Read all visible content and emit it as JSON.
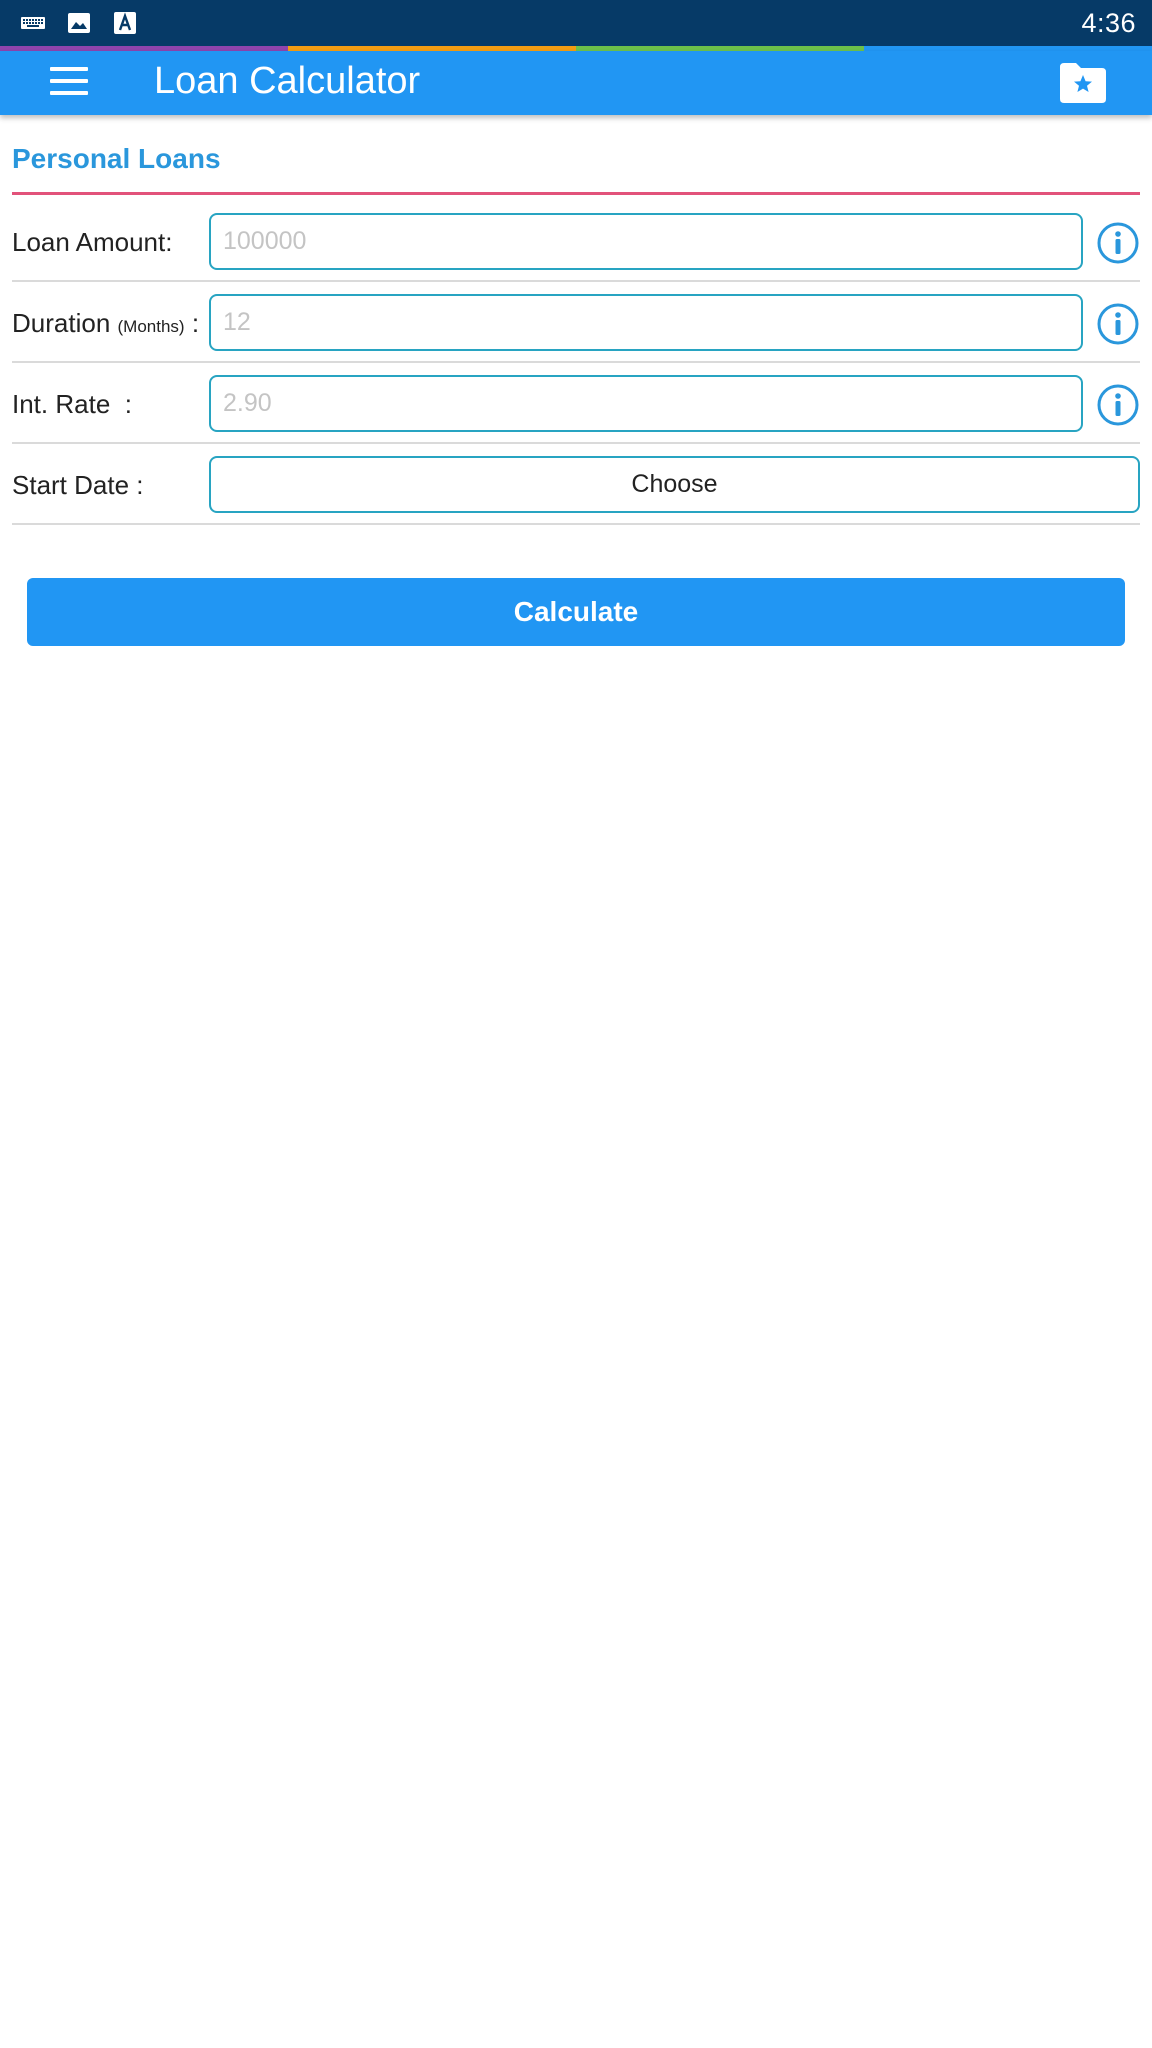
{
  "status_bar": {
    "time": "4:36",
    "icons": [
      "keyboard-icon",
      "image-icon",
      "text-a-icon"
    ]
  },
  "app_bar": {
    "title": "Loan Calculator",
    "menu_icon": "hamburger-menu-icon",
    "action_icon": "favorite-folder-icon",
    "color": "#2196f3"
  },
  "section": {
    "title": "Personal Loans",
    "rule_color": "#e2527a"
  },
  "form": {
    "loan_amount": {
      "label": "Loan Amount",
      "colon": ":",
      "placeholder": "100000",
      "value": ""
    },
    "duration": {
      "label": "Duration",
      "label_small": "(Months)",
      "colon": ":",
      "placeholder": "12",
      "value": ""
    },
    "int_rate": {
      "label": "Int. Rate",
      "colon": ":",
      "placeholder": "2.90",
      "value": ""
    },
    "start_date": {
      "label": "Start Date",
      "colon": ":",
      "button_label": "Choose"
    }
  },
  "actions": {
    "calculate_label": "Calculate"
  },
  "colors": {
    "status_bar": "#063a67",
    "accent": "#2a97dc",
    "field_border": "#28a4c2",
    "strip": [
      "#8e44ad",
      "#f39c12",
      "#6cc04a",
      "#2196f3"
    ]
  }
}
